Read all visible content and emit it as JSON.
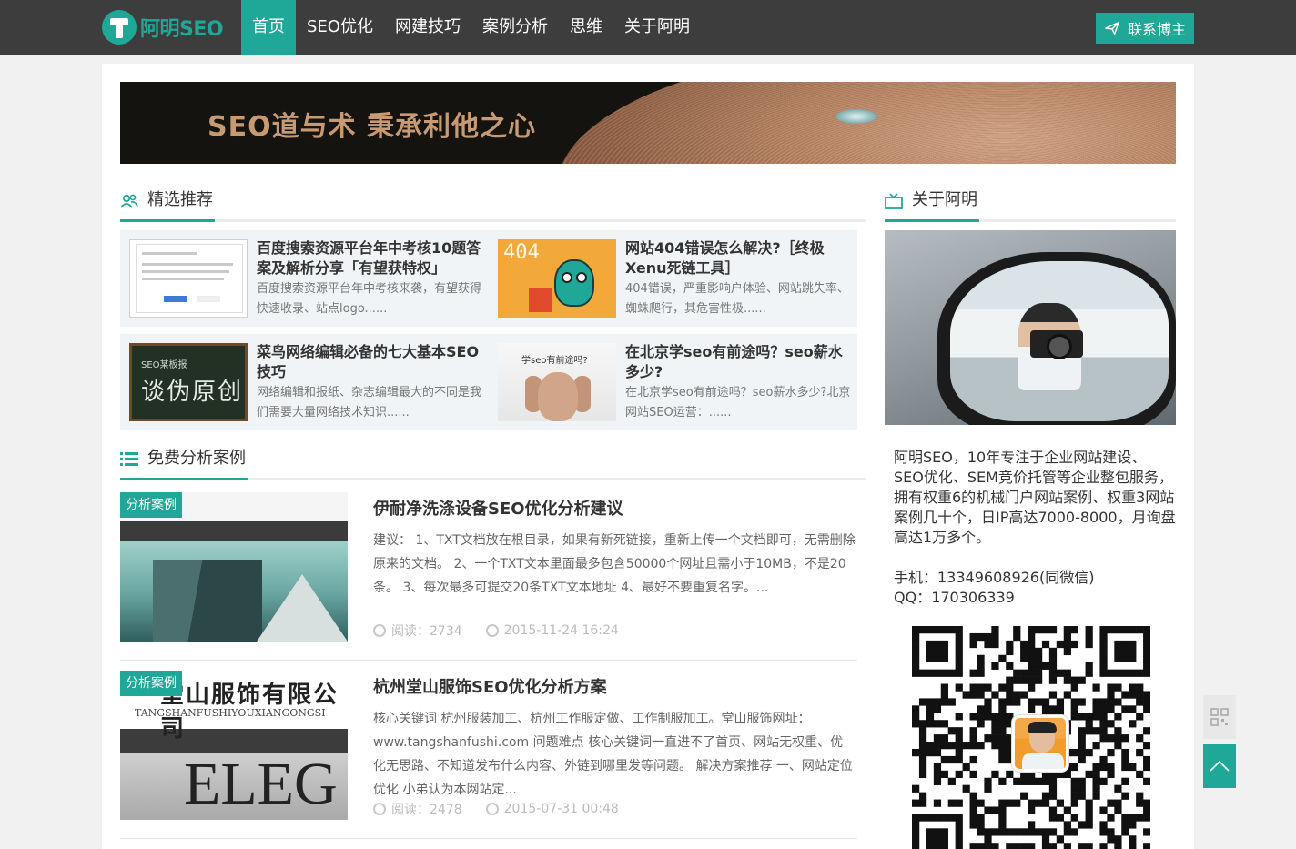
{
  "brand": {
    "name": "阿明SEO"
  },
  "nav": {
    "items": [
      {
        "label": "首页",
        "active": true
      },
      {
        "label": "SEO优化",
        "active": false
      },
      {
        "label": "网建技巧",
        "active": false
      },
      {
        "label": "案例分析",
        "active": false
      },
      {
        "label": "思维",
        "active": false
      },
      {
        "label": "关于阿明",
        "active": false
      }
    ],
    "contact_label": "联系博主"
  },
  "banner": {
    "text": "SEO道与术 秉承利他之心"
  },
  "featured": {
    "heading": "精选推荐",
    "items": [
      {
        "title": "百度搜索资源平台年中考核10题答案及解析分享「有望获特权」",
        "excerpt": "百度搜索资源平台年中考核来袭，有望获得快速收录、站点logo......"
      },
      {
        "title": "网站404错误怎么解决?［终极Xenu死链工具］",
        "excerpt": "404错误，严重影响户体验、网站跳失率、蜘蛛爬行，其危害性极......"
      },
      {
        "title": "菜鸟网络编辑必备的七大基本SEO技巧",
        "excerpt": "网络编辑和报纸、杂志编辑最大的不同是我们需要大量网络技术知识......"
      },
      {
        "title": "在北京学seo有前途吗？seo薪水多少?",
        "excerpt": "在北京学seo有前途吗？seo薪水多少?北京网站SEO运营：......"
      }
    ],
    "thumb_text": {
      "t404": "404",
      "chalk_small": "SEO某板报",
      "chalk_big": "谈伪原创",
      "head_q": "学seo有前途吗?"
    }
  },
  "cases": {
    "heading": "免费分析案例",
    "badge": "分析案例",
    "items": [
      {
        "title": "伊耐净洗涤设备SEO优化分析建议",
        "excerpt": "建议： 1、TXT文档放在根目录，如果有新死链接，重新上传一个文档即可，无需删除原来的文档。 2、一个TXT文本里面最多包含50000个网址且需小于10MB，不是20条。 3、每次最多可提交20条TXT文本地址 4、最好不要重复名字。...",
        "reads": "阅读：2734",
        "date": "2015-11-24 16:24"
      },
      {
        "title": "杭州堂山服饰SEO优化分析方案",
        "excerpt": "核心关键词 杭州服装加工、杭州工作服定做、工作制服加工。堂山服饰网址：www.tangshanfushi.com 问题难点 核心关键词一直进不了首页、网站无权重、优化无思路、不知道发布什么内容、外链到哪里发等问题。 解决方案推荐 一、网站定位优化 小弟认为本网站定...",
        "reads": "阅读：2478",
        "date": "2015-07-31 00:48"
      }
    ],
    "img_text": {
      "brand2": "堂山服饰有限公司",
      "sub2": "TANGSHANFUSHIYOUXIANGONGSI",
      "eleg": "ELEG"
    }
  },
  "about": {
    "heading": "关于阿明",
    "text": "阿明SEO，10年专注于企业网站建设、SEO优化、SEM竞价托管等企业整包服务，拥有权重6的机械门户网站案例、权重3网站案例几十个，日IP高达7000-8000，月询盘高达1万多个。",
    "phone": "手机：13349608926(同微信)",
    "qq": "QQ：170306339"
  },
  "colors": {
    "accent": "#1fa897",
    "topbar": "#3d3d3d"
  }
}
